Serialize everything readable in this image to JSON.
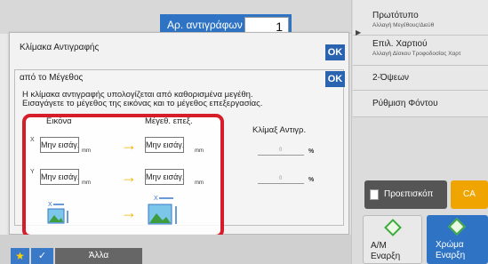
{
  "header": {
    "copies_label": "Αρ. αντιγράφων",
    "copies_value": "1"
  },
  "sidebar": {
    "original_title": "Πρωτότυπο",
    "original_sub": "Αλλαγή Μεγέθους/Διεύθ",
    "paper_title": "Επιλ. Χαρτιού",
    "paper_sub": "Αλλαγή Δίσκου Τροφοδοσίας Χαρτ",
    "duplex": "2-Όψεων",
    "background": "Ρύθμιση Φόντου",
    "preview": "Προεπισκόπ",
    "ca": "CA",
    "bw_start_line1": "Α/Μ",
    "bw_start_line2": "Εναρξη",
    "color_start_line1": "Χρώμα",
    "color_start_line2": "Εναρξη"
  },
  "dialog": {
    "title": "Κλίμακα Αντιγραφής",
    "ok": "OK",
    "sub_title": "από το Μέγεθος",
    "sub_ok": "OK",
    "desc_line1": "Η κλίμακα αντιγραφής υπολογίζεται από καθορισμένα μεγέθη.",
    "desc_line2": "Εισαγάγετε το μέγεθος της εικόνας και το μέγεθος επεξεργασίας.",
    "col_image": "Εικόνα",
    "col_output": "Μέγεθ. επεξ.",
    "col_ratio": "Κλίμαξ Αντιγρ.",
    "axis_x": "X",
    "axis_y": "Y",
    "placeholder": "Μην εισάγ.",
    "unit": "mm",
    "ratio_placeholder": "0",
    "percent": "%"
  },
  "bottom": {
    "other": "Άλλα"
  },
  "colors": {
    "accent": "#2f74c4",
    "highlight": "#d61e2a",
    "ca": "#f0a400",
    "ok": "#2a63b0"
  }
}
